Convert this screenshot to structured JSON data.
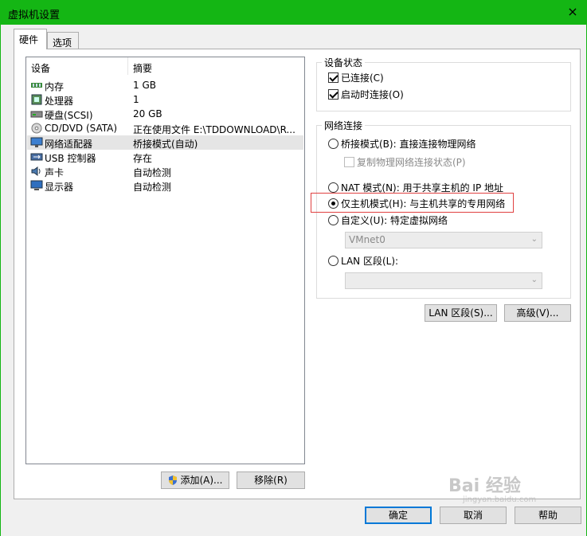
{
  "window": {
    "title": "虚拟机设置",
    "close_icon": "×"
  },
  "tabs": [
    {
      "label": "硬件"
    },
    {
      "label": "选项"
    }
  ],
  "device_list": {
    "columns": [
      "设备",
      "摘要"
    ],
    "rows": [
      {
        "device": "内存",
        "summary": "1 GB",
        "icon": "memory-icon"
      },
      {
        "device": "处理器",
        "summary": "1",
        "icon": "processor-icon"
      },
      {
        "device": "硬盘(SCSI)",
        "summary": "20 GB",
        "icon": "hard-disk-icon"
      },
      {
        "device": "CD/DVD (SATA)",
        "summary": "正在使用文件 E:\\TDDOWNLOAD\\R...",
        "icon": "cd-dvd-icon"
      },
      {
        "device": "网络适配器",
        "summary": "桥接模式(自动)",
        "icon": "network-adapter-icon"
      },
      {
        "device": "USB 控制器",
        "summary": "存在",
        "icon": "usb-icon"
      },
      {
        "device": "声卡",
        "summary": "自动检测",
        "icon": "sound-card-icon"
      },
      {
        "device": "显示器",
        "summary": "自动检测",
        "icon": "display-icon"
      }
    ],
    "selected_index": 4
  },
  "list_buttons": {
    "add": "添加(A)...",
    "remove": "移除(R)"
  },
  "device_status": {
    "title": "设备状态",
    "connected": "已连接(C)",
    "connect_at_power_on": "启动时连接(O)"
  },
  "network_connection": {
    "title": "网络连接",
    "bridged": "桥接模式(B): 直接连接物理网络",
    "replicate": "复制物理网络连接状态(P)",
    "nat": "NAT 模式(N): 用于共享主机的 IP 地址",
    "host_only": "仅主机模式(H): 与主机共享的专用网络",
    "custom": "自定义(U): 特定虚拟网络",
    "custom_value": "VMnet0",
    "lan_segment": "LAN 区段(L):",
    "lan_segment_value": ""
  },
  "network_buttons": {
    "lan_segments": "LAN 区段(S)...",
    "advanced": "高级(V)..."
  },
  "footer": {
    "ok": "确定",
    "cancel": "取消",
    "help": "帮助"
  },
  "watermark": {
    "text": "Bai 经验",
    "url": "jingyan.baidu.com"
  }
}
